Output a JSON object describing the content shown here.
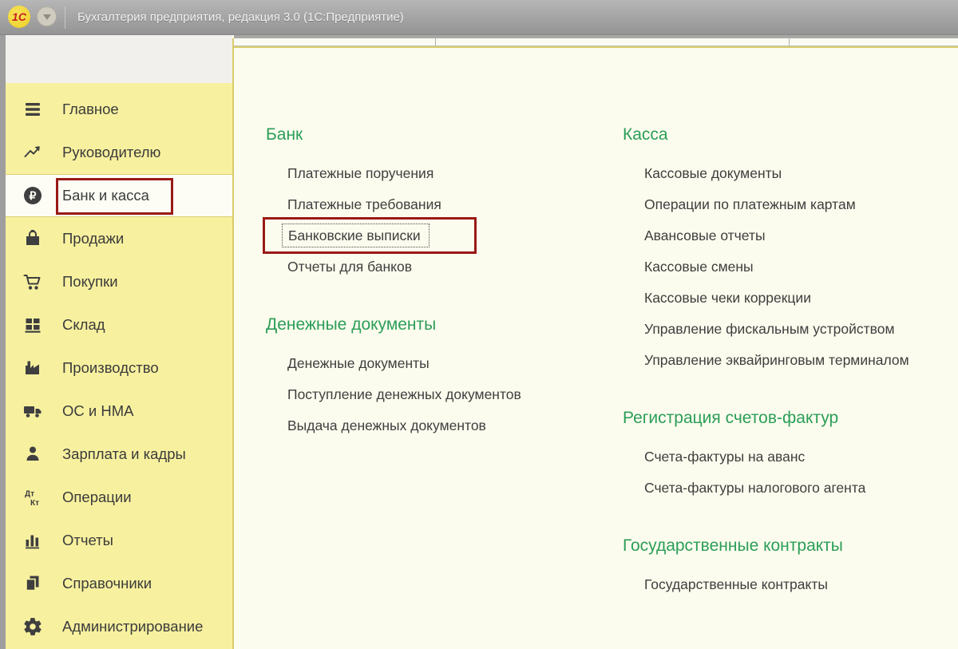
{
  "window": {
    "logo_text": "1С",
    "title": "Бухгалтерия предприятия, редакция 3.0  (1С:Предприятие)"
  },
  "toolbar": {
    "icons": [
      "menu-grid",
      "favorites-star",
      "history-scroll",
      "search",
      "notifications-bell"
    ]
  },
  "sidebar": {
    "items": [
      {
        "label": "Главное",
        "icon": "hamburger-menu"
      },
      {
        "label": "Руководителю",
        "icon": "trend-arrow"
      },
      {
        "label": "Банк и касса",
        "icon": "ruble-circle",
        "selected": true,
        "annotated": true
      },
      {
        "label": "Продажи",
        "icon": "shopping-bag"
      },
      {
        "label": "Покупки",
        "icon": "shopping-cart"
      },
      {
        "label": "Склад",
        "icon": "pallet-grid"
      },
      {
        "label": "Производство",
        "icon": "factory"
      },
      {
        "label": "ОС и НМА",
        "icon": "truck"
      },
      {
        "label": "Зарплата и кадры",
        "icon": "person"
      },
      {
        "label": "Операции",
        "icon": "debit-credit"
      },
      {
        "label": "Отчеты",
        "icon": "bar-chart"
      },
      {
        "label": "Справочники",
        "icon": "stacked-pages"
      },
      {
        "label": "Администрирование",
        "icon": "gear"
      }
    ]
  },
  "content": {
    "columns": [
      {
        "sections": [
          {
            "title": "Банк",
            "items": [
              "Платежные поручения",
              "Платежные требования",
              "Банковские выписки",
              "Отчеты для банков"
            ],
            "focused_item": "Банковские выписки"
          },
          {
            "title": "Денежные документы",
            "items": [
              "Денежные документы",
              "Поступление денежных документов",
              "Выдача денежных документов"
            ]
          }
        ]
      },
      {
        "sections": [
          {
            "title": "Касса",
            "items": [
              "Кассовые документы",
              "Операции по платежным картам",
              "Авансовые отчеты",
              "Кассовые смены",
              "Кассовые чеки коррекции",
              "Управление фискальным устройством",
              "Управление эквайринговым терминалом"
            ]
          },
          {
            "title": "Регистрация счетов-фактур",
            "items": [
              "Счета-фактуры на аванс",
              "Счета-фактуры налогового агента"
            ]
          },
          {
            "title": "Государственные контракты",
            "items": [
              "Государственные контракты"
            ]
          }
        ]
      }
    ]
  },
  "colors": {
    "accent_green": "#2b9e58",
    "sidebar_yellow": "#f7f09f",
    "annotation_red": "#9a1915",
    "panel_border_yellow": "#d9cc6b",
    "titlebar_gray": "#a6a6a6"
  }
}
